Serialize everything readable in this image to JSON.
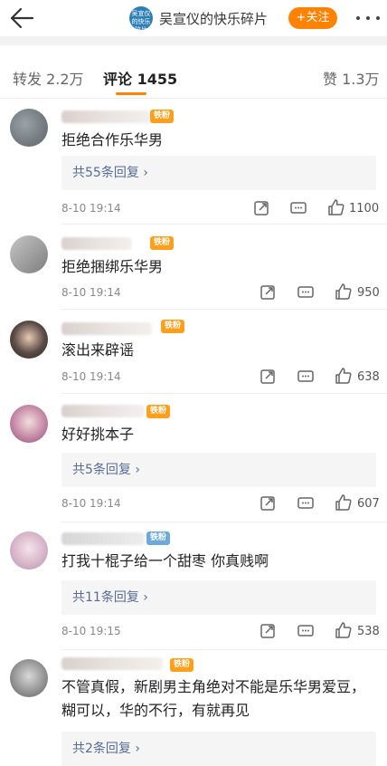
{
  "header": {
    "logo_text": "吴宣仪的快乐碎片",
    "title": "吴宣仪的快乐碎片",
    "follow_label": "+关注"
  },
  "tabs": [
    {
      "label": "转发 2.2万"
    },
    {
      "label": "评论 1455",
      "active": true
    },
    {
      "label": "赞 1.3万"
    }
  ],
  "comments": [
    {
      "badge": "铁粉",
      "text": "拒绝合作乐华男",
      "replies": "共55条回复 ›",
      "time": "8-10 19:14",
      "likes": "1100"
    },
    {
      "badge": "铁粉",
      "text": "拒绝捆绑乐华男",
      "replies": "",
      "time": "8-10 19:14",
      "likes": "950"
    },
    {
      "badge": "铁粉",
      "text": "滚出来辟谣",
      "replies": "",
      "time": "8-10 19:14",
      "likes": "638"
    },
    {
      "badge": "铁粉",
      "text": "好好挑本子",
      "replies": "共5条回复 ›",
      "time": "8-10 19:14",
      "likes": "607"
    },
    {
      "badge": "铁粉",
      "text": "打我十棍子给一个甜枣 你真贱啊",
      "replies": "共11条回复 ›",
      "time": "8-10 19:15",
      "likes": "538"
    },
    {
      "badge": "铁粉",
      "text": "不管真假，新剧男主角绝对不能是乐华男爱豆，糊可以，华的不行，有就再见",
      "replies": "共2条回复 ›",
      "time": "",
      "likes": ""
    }
  ],
  "colors": {
    "accent": "#ff8200",
    "link": "#576b95",
    "badge": "#ff9f1c"
  }
}
